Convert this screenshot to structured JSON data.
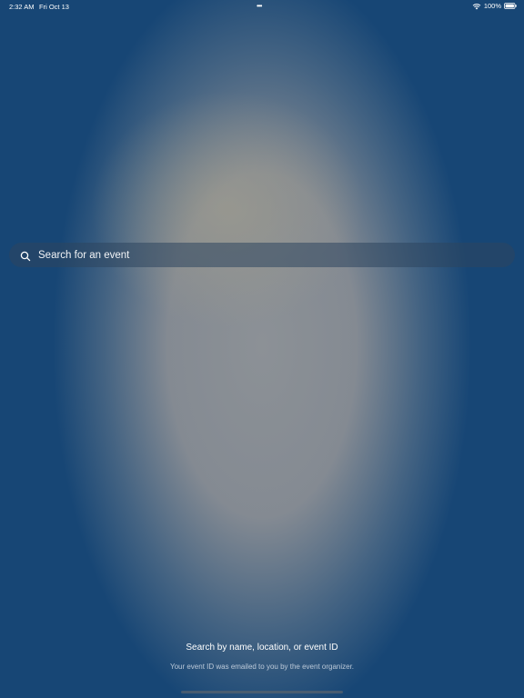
{
  "status_bar": {
    "time": "2:32 AM",
    "date": "Fri Oct 13",
    "multitask_dots": "•••",
    "battery_percent": "100%",
    "battery_level": 1.0,
    "icons": [
      "wifi-icon",
      "battery-icon"
    ]
  },
  "search": {
    "placeholder": "Search for an event",
    "value": "",
    "icon": "search-icon"
  },
  "empty_state": {
    "title": "Search by name, location, or event ID",
    "subtitle": "Your event ID was emailed to you by the event organizer."
  },
  "colors": {
    "background": "#174675",
    "text": "#ffffff"
  }
}
